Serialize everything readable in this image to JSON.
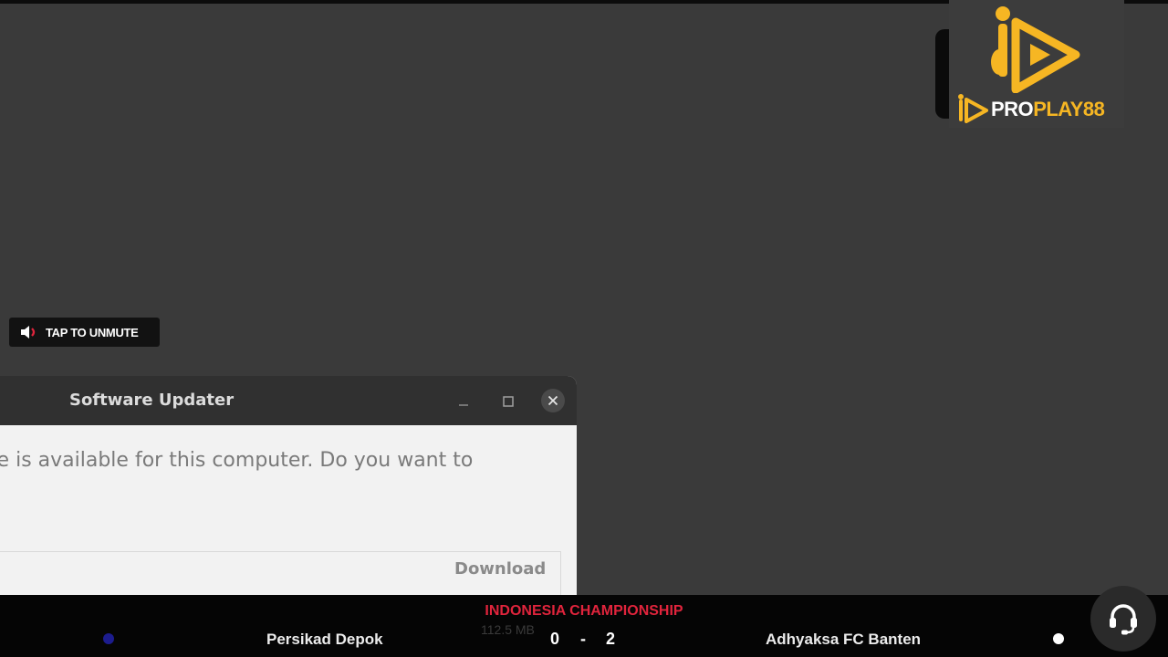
{
  "brand": {
    "logo_text_white": "PRO",
    "logo_text_gold": "PLAY88",
    "gold": "#f6b623"
  },
  "unmute": {
    "label": "TAP TO UNMUTE",
    "icon": "speaker-muted-icon"
  },
  "dialog": {
    "title": "Software Updater",
    "message": "re is available for this computer. Do you want to",
    "download_label": "Download",
    "ghost_text": "112.5 MB"
  },
  "scoreboard": {
    "league": "INDONESIA CHAMPIONSHIP",
    "home_team": "Persikad Depok",
    "home_score": "0",
    "separator": "-",
    "away_score": "2",
    "away_team": "Adhyaksa FC Banten",
    "home_color": "#1c1c8e",
    "away_color": "#ffffff",
    "league_color": "#e0243c"
  },
  "support": {
    "icon": "headset-icon"
  }
}
